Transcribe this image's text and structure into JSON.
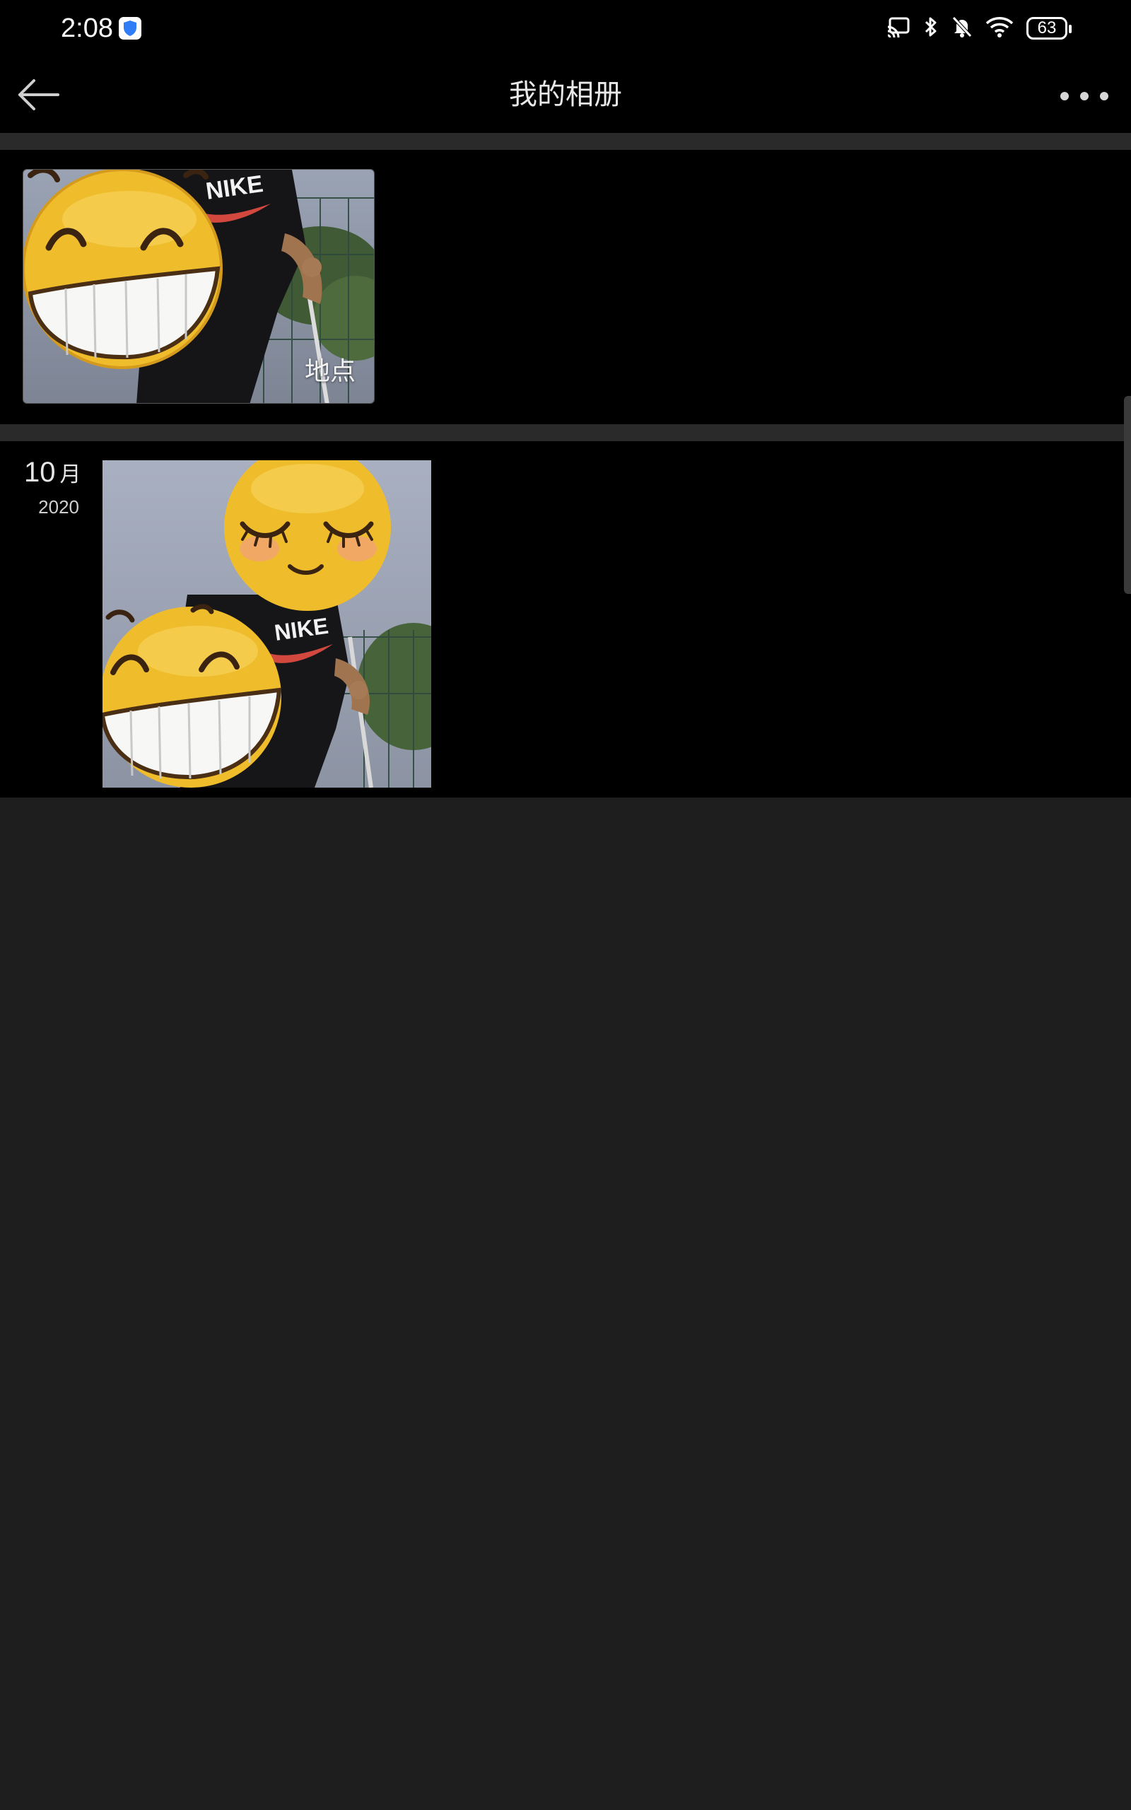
{
  "status_bar": {
    "time": "2:08",
    "battery": "63",
    "icons": [
      "cast-icon",
      "bluetooth-icon",
      "mute-bell-icon",
      "wifi-icon",
      "battery-icon"
    ]
  },
  "header": {
    "title": "我的相册",
    "back_icon": "back-arrow-icon",
    "more_icon": "more-dots-icon"
  },
  "albums": [
    {
      "label": "地点"
    }
  ],
  "timeline": [
    {
      "month": "10",
      "month_unit": "月",
      "year": "2020",
      "photo_count": 1
    }
  ],
  "colors": {
    "background": "#1e1e1e",
    "surface": "#000000",
    "divider": "#2a2a2a",
    "text_primary": "#e8e8e8",
    "emoji_yellow": "#f2c230"
  }
}
